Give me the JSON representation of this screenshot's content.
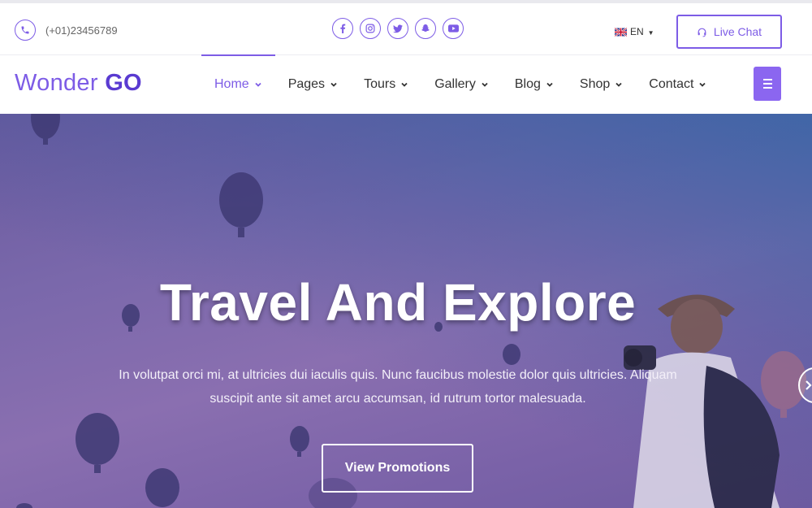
{
  "topbar": {
    "phone_icon": "phone-icon",
    "phone": "(+01)23456789",
    "socials": [
      "facebook-icon",
      "instagram-icon",
      "twitter-icon",
      "snapchat-icon",
      "youtube-icon"
    ],
    "language": "EN",
    "live_chat_label": "Live Chat"
  },
  "nav": {
    "logo_light": "Wonder",
    "logo_bold": "GO",
    "items": [
      {
        "label": "Home",
        "active": true
      },
      {
        "label": "Pages"
      },
      {
        "label": "Tours"
      },
      {
        "label": "Gallery"
      },
      {
        "label": "Blog"
      },
      {
        "label": "Shop"
      },
      {
        "label": "Contact"
      }
    ]
  },
  "hero": {
    "title": "Travel And Explore",
    "subtitle": "In volutpat orci mi, at ultricies dui iaculis quis. Nunc faucibus molestie dolor quis ultricies. Aliquam suscipit ante sit amet arcu accumsan, id rutrum tortor malesuada.",
    "cta_label": "View Promotions"
  },
  "colors": {
    "accent": "#7d5ce6",
    "accent_dark": "#5a3bd1"
  }
}
